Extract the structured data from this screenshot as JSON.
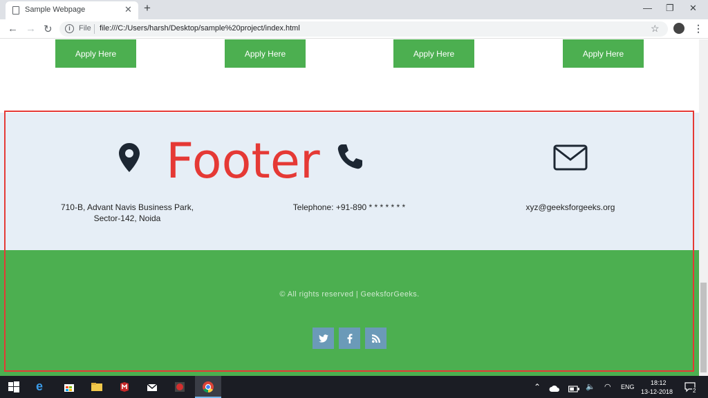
{
  "browser": {
    "tab_title": "Sample Webpage",
    "file_label": "File",
    "url": "file:///C:/Users/harsh/Desktop/sample%20project/index.html"
  },
  "page": {
    "apply_buttons": [
      "Apply Here",
      "Apply Here",
      "Apply Here",
      "Apply Here"
    ],
    "footer": {
      "address_line1": "710-B, Advant Navis Business Park,",
      "address_line2": "Sector-142, Noida",
      "telephone": "Telephone: +91-890 * * * * * * *",
      "email": "xyz@geeksforgeeks.org",
      "copyright": "© All rights reserved | GeeksforGeeks.",
      "social": [
        "twitter-icon",
        "facebook-icon",
        "rss-icon"
      ]
    },
    "annotation": "Footer"
  },
  "taskbar": {
    "language": "ENG",
    "time": "18:12",
    "date": "13-12-2018",
    "notifications": "2"
  },
  "colors": {
    "accent_green": "#4caf50",
    "annotation_red": "#e53935",
    "social_blue": "#6b9ab8"
  }
}
